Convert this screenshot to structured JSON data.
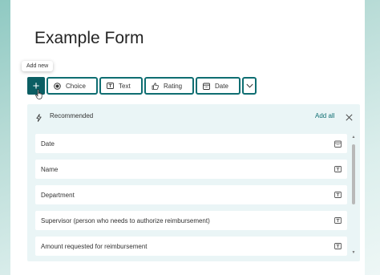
{
  "form": {
    "title": "Example Form"
  },
  "tooltip": {
    "text": "Add new"
  },
  "toolbar": {
    "add_label": "+",
    "choice_label": "Choice",
    "text_label": "Text",
    "rating_label": "Rating",
    "date_label": "Date",
    "more_icon": "chevron-down-icon"
  },
  "recommended": {
    "label": "Recommended",
    "add_all": "Add all",
    "icon": "lightning-icon",
    "items": [
      {
        "label": "Date",
        "icon": "calendar-icon"
      },
      {
        "label": "Name",
        "icon": "text-icon"
      },
      {
        "label": "Department",
        "icon": "text-icon"
      },
      {
        "label": "Supervisor (person who needs to authorize reimbursement)",
        "icon": "text-icon"
      },
      {
        "label": "Amount requested for reimbursement",
        "icon": "text-icon"
      }
    ]
  },
  "colors": {
    "accent": "#0f6e72",
    "add_button": "#0b5e63",
    "panel_bg": "#eaf5f6"
  }
}
